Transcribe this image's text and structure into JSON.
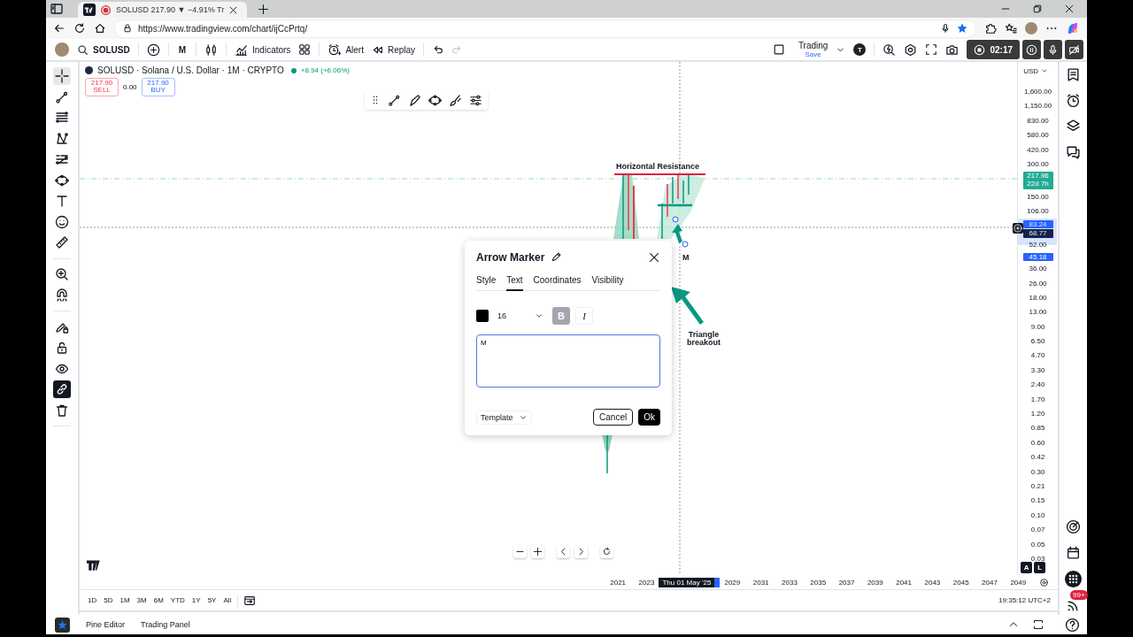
{
  "browser": {
    "tab_title": "SOLUSD 217.90 ▼ −4.91% Tr",
    "url": "https://www.tradingview.com/chart/ijCcPrtq/"
  },
  "top_toolbar": {
    "symbol": "SOLUSD",
    "interval": "M",
    "indicators": "Indicators",
    "alert": "Alert",
    "replay": "Replay",
    "layout": "Trading",
    "layout_status": "Save",
    "account": "T",
    "rec_time": "02:17"
  },
  "left_tools": [
    {
      "kind": "crosshair",
      "selected": true,
      "on": false
    },
    {
      "kind": "trend-line",
      "selected": false,
      "on": false
    },
    {
      "kind": "fib",
      "selected": false,
      "on": false
    },
    {
      "kind": "pattern",
      "selected": false,
      "on": false
    },
    {
      "kind": "forecast",
      "selected": false,
      "on": false
    },
    {
      "kind": "ellipse",
      "selected": false,
      "on": false
    },
    {
      "kind": "text",
      "selected": false,
      "on": false
    },
    {
      "kind": "smiley",
      "selected": false,
      "on": false
    },
    {
      "kind": "ruler",
      "selected": false,
      "on": false
    },
    {
      "kind": "zoom",
      "selected": false,
      "on": false
    },
    {
      "kind": "magnet",
      "selected": false,
      "on": false
    },
    {
      "kind": "pencil-lock",
      "selected": false,
      "on": false
    },
    {
      "kind": "lock",
      "selected": false,
      "on": false
    },
    {
      "kind": "eye",
      "selected": false,
      "on": false
    },
    {
      "kind": "link",
      "selected": false,
      "on": true
    },
    {
      "kind": "trash",
      "selected": false,
      "on": false
    }
  ],
  "legend": {
    "title": "SOLUSD · Solana / U.S. Dollar · 1M · CRYPTO",
    "change": "+8.94 (+6.06%)",
    "sell_price": "217.90",
    "sell_label": "SELL",
    "spread": "0.00",
    "buy_price": "217.90",
    "buy_label": "BUY"
  },
  "chart": {
    "resistance_label": "Horizontal Resistance",
    "marker_label": "M",
    "breakout_label": "Triangle breakout"
  },
  "price_axis": {
    "currency": "USD",
    "items": [
      {
        "kind": "label",
        "text": "1,600.00"
      },
      {
        "kind": "label",
        "text": "1,150.00"
      },
      {
        "kind": "label",
        "text": "830.00"
      },
      {
        "kind": "label",
        "text": "580.00"
      },
      {
        "kind": "label",
        "text": "420.00"
      },
      {
        "kind": "label",
        "text": "300.00"
      },
      {
        "kind": "last-price",
        "text": "217.96",
        "sub": "22d 7h"
      },
      {
        "kind": "label",
        "text": "150.00"
      },
      {
        "kind": "label",
        "text": "106.00"
      },
      {
        "kind": "marker",
        "text": "83.24"
      },
      {
        "kind": "crosshair",
        "text": "68.77"
      },
      {
        "kind": "label",
        "text": "52.00"
      },
      {
        "kind": "marker",
        "text": "45.18"
      },
      {
        "kind": "label",
        "text": "36.00"
      },
      {
        "kind": "label",
        "text": "26.00"
      },
      {
        "kind": "label",
        "text": "18.00"
      },
      {
        "kind": "label",
        "text": "13.00"
      },
      {
        "kind": "label",
        "text": "9.00"
      },
      {
        "kind": "label",
        "text": "6.50"
      },
      {
        "kind": "label",
        "text": "4.70"
      },
      {
        "kind": "label",
        "text": "3.30"
      },
      {
        "kind": "label",
        "text": "2.40"
      },
      {
        "kind": "label",
        "text": "1.70"
      },
      {
        "kind": "label",
        "text": "1.20"
      },
      {
        "kind": "label",
        "text": "0.85"
      },
      {
        "kind": "label",
        "text": "0.60"
      },
      {
        "kind": "label",
        "text": "0.42"
      },
      {
        "kind": "label",
        "text": "0.30"
      },
      {
        "kind": "label",
        "text": "0.21"
      },
      {
        "kind": "label",
        "text": "0.15"
      },
      {
        "kind": "label",
        "text": "0.10"
      },
      {
        "kind": "label",
        "text": "0.07"
      },
      {
        "kind": "label",
        "text": "0.05"
      },
      {
        "kind": "label",
        "text": "0.03"
      }
    ]
  },
  "scale_buttons": [
    "A",
    "L"
  ],
  "time_axis": {
    "years_before": [
      "2021",
      "2023"
    ],
    "crosshair_label": "Thu 01 May '25",
    "years_after": [
      "2029",
      "2031",
      "2033",
      "2035",
      "2037",
      "2039",
      "2041",
      "2043",
      "2045",
      "2047",
      "2049"
    ]
  },
  "range_buttons": [
    "1D",
    "5D",
    "1M",
    "3M",
    "6M",
    "YTD",
    "1Y",
    "5Y",
    "All"
  ],
  "clock": "19:35:12 UTC+2",
  "bottom_tabs": [
    "Pine Editor",
    "Trading Panel"
  ],
  "notifications": "99+",
  "dialog": {
    "title": "Arrow Marker",
    "tabs": [
      {
        "label": "Style",
        "selected": false
      },
      {
        "label": "Text",
        "selected": true
      },
      {
        "label": "Coordinates",
        "selected": false
      },
      {
        "label": "Visibility",
        "selected": false
      }
    ],
    "font_size": "16",
    "format_buttons": [
      {
        "label": "B",
        "on": true
      },
      {
        "label": "I",
        "on": false
      }
    ],
    "text": "M",
    "template": "Template",
    "cancel": "Cancel",
    "ok": "Ok"
  }
}
